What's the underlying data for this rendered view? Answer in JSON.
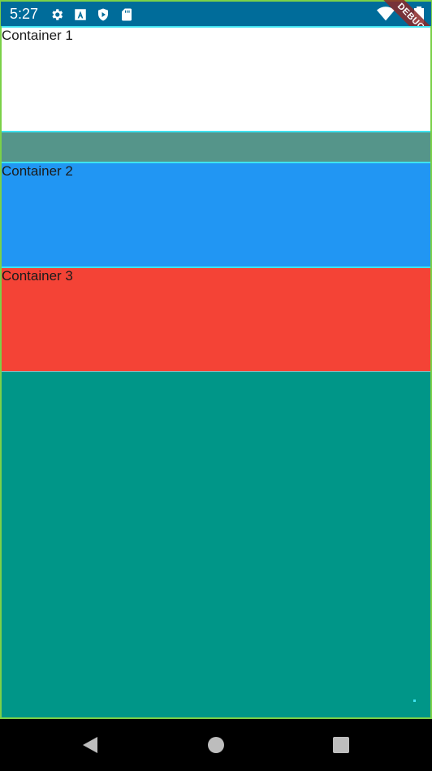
{
  "status_bar": {
    "time": "5:27",
    "icons": [
      "gear-icon",
      "a-icon",
      "play-shield-icon",
      "sd-card-icon"
    ],
    "right_icons": [
      "wifi-icon",
      "battery-icon"
    ]
  },
  "debug_banner": "DEBUG",
  "containers": [
    {
      "label": "Container 1",
      "color": "#ffffff"
    },
    {
      "label": "Container 2",
      "color": "#2196f3"
    },
    {
      "label": "Container 3",
      "color": "#f44336"
    }
  ],
  "colors": {
    "status_bar": "#006c9a",
    "gap": "#55958a",
    "bottom": "#009688",
    "outline": "#3ee3f0"
  },
  "nav_bar": {
    "buttons": [
      "back-icon",
      "home-icon",
      "recents-icon"
    ]
  }
}
